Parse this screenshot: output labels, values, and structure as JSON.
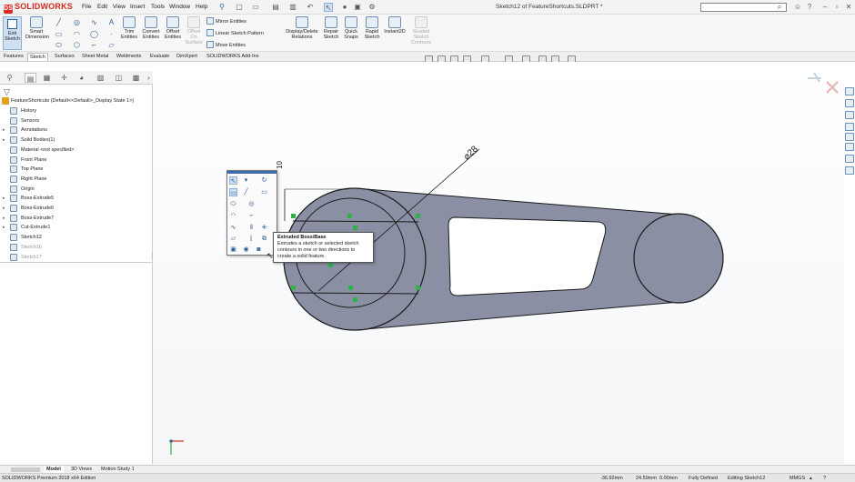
{
  "app": {
    "logo_text": "SOLIDWORKS",
    "document_title": "Sketch12 of FeatureShortcuts.SLDPRT *",
    "menu": [
      "File",
      "Edit",
      "View",
      "Insert",
      "Tools",
      "Window",
      "Help"
    ]
  },
  "command_manager": {
    "exit_sketch": "Exit Sketch",
    "smart_dimension": "Smart Dimension",
    "trim_entities": "Trim Entities",
    "convert_entities": "Convert Entities",
    "offset_entities": "Offset Entities",
    "offset_on_surface": "Offset On Surface",
    "mirror_entities": "Mirror Entities",
    "linear_sketch_pattern": "Linear Sketch Pattern",
    "move_entities": "Move Entities",
    "display_delete_relations": "Display/Delete Relations",
    "repair_sketch": "Repair Sketch",
    "quick_snaps": "Quick Snaps",
    "rapid_sketch": "Rapid Sketch",
    "instant2d": "Instant2D",
    "shaded_sketch_contours": "Shaded Sketch Contours"
  },
  "tabs": [
    "Features",
    "Sketch",
    "Surfaces",
    "Sheet Metal",
    "Weldments",
    "Evaluate",
    "DimXpert",
    "SOLIDWORKS Add-Ins"
  ],
  "active_tab": "Sketch",
  "feature_tree": {
    "root": "FeatureShortcuts  (Default<<Default>_Display State 1>)",
    "items": [
      {
        "label": "History",
        "expand": false
      },
      {
        "label": "Sensors",
        "expand": false
      },
      {
        "label": "Annotations",
        "expand": true
      },
      {
        "label": "Solid Bodies(1)",
        "expand": true
      },
      {
        "label": "Material <not specified>",
        "expand": false
      },
      {
        "label": "Front Plane",
        "expand": false
      },
      {
        "label": "Top Plane",
        "expand": false
      },
      {
        "label": "Right Plane",
        "expand": false
      },
      {
        "label": "Origin",
        "expand": false
      },
      {
        "label": "Boss-Extrude5",
        "expand": true
      },
      {
        "label": "Boss-Extrude6",
        "expand": true
      },
      {
        "label": "Boss-Extrude7",
        "expand": true
      },
      {
        "label": "Cut-Extrude1",
        "expand": true
      },
      {
        "label": "Sketch12",
        "expand": false
      },
      {
        "label": "Sketch16",
        "expand": false,
        "grey": true
      },
      {
        "label": "Sketch17",
        "expand": false,
        "grey": true
      }
    ]
  },
  "graphics": {
    "dimension_label": "⌀28",
    "vertical_dim_label": "10"
  },
  "tooltip": {
    "title": "Extruded Boss/Base",
    "description": "Extrudes a sketch or selected sketch contours in one or two directions to create a solid feature."
  },
  "bottom_tabs": [
    "Model",
    "3D Views",
    "Motion Study 1"
  ],
  "status": {
    "edition": "SOLIDWORKS Premium 2018 x64 Edition",
    "x": "-36.92mm",
    "y": "24.59mm",
    "z": "0.00mm",
    "state": "Fully Defined",
    "editing": "Editing Sketch12",
    "units": "MMGS"
  },
  "colors": {
    "part_fill": "#8a8fa3",
    "sketch_line": "#1a1a1a",
    "relation_green": "#2db34a",
    "brand_red": "#d52b1e"
  }
}
